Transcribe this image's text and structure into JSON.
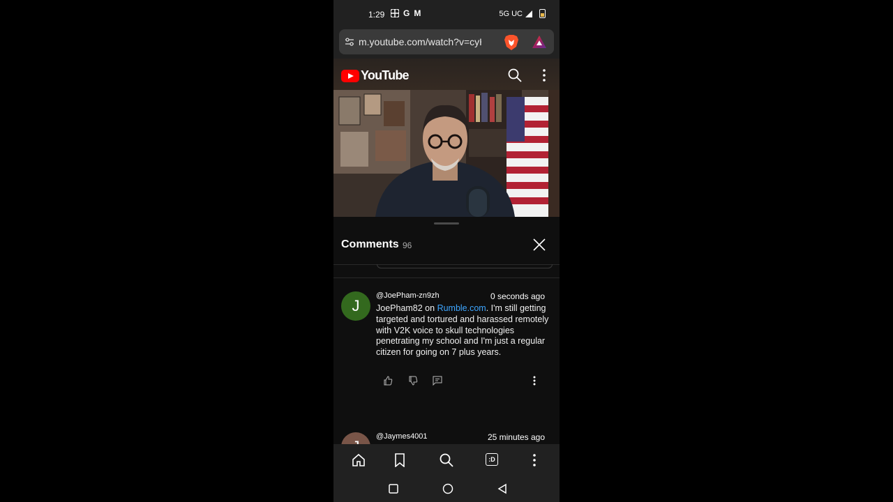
{
  "status_bar": {
    "time": "1:29",
    "left_icons": [
      "pinwheel-icon",
      "G",
      "M"
    ],
    "network": "5G UC",
    "battery_color": "#e8b84a"
  },
  "browser": {
    "url": "m.youtube.com/watch?v=cyHq",
    "shield_icon": "brave-lion-icon",
    "rewards_icon": "brave-rewards-triangle-icon"
  },
  "youtube_header": {
    "logo_text": "YouTube",
    "brand_color": "#ff0000"
  },
  "comments": {
    "title": "Comments",
    "count": "96",
    "items": [
      {
        "avatar_letter": "J",
        "avatar_color": "#33691e",
        "author": "@JoePham-zn9zh",
        "time": "0 seconds ago",
        "text_pre": "JoePham82 on ",
        "link": "Rumble.com",
        "text_post": ". I'm still getting targeted and tortured and harassed remotely with V2K voice to skull technologies penetrating my school and I'm just a regular citizen for going on 7 plus years."
      },
      {
        "avatar_letter": "J",
        "avatar_color": "#795548",
        "author": "@Jaymes4001",
        "time": "25 minutes ago"
      }
    ]
  },
  "toolbar": {
    "icons": [
      "home-icon",
      "bookmark-icon",
      "search-icon",
      "tab-switcher-icon",
      "menu-icon"
    ],
    "tab_label": ":D"
  },
  "navigation": {
    "icons": [
      "recents-icon",
      "home-circle-icon",
      "back-icon"
    ]
  }
}
